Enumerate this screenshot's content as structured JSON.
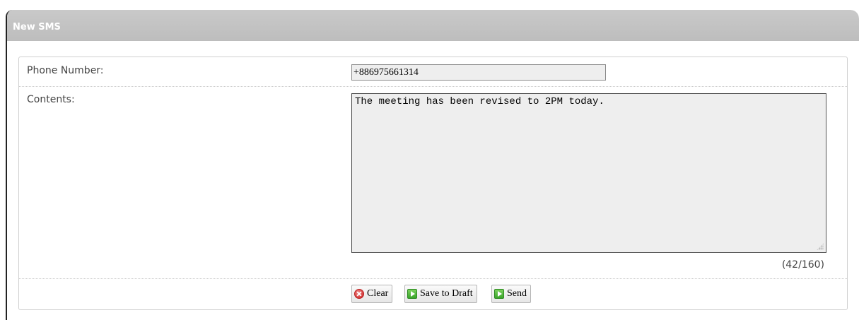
{
  "panel": {
    "title": "New SMS"
  },
  "form": {
    "phone_label": "Phone Number:",
    "phone_value": "+886975661314",
    "contents_label": "Contents:",
    "contents_value": "The meeting has been revised to 2PM today.",
    "counter": "(42/160)"
  },
  "buttons": {
    "clear": "Clear",
    "save_draft": "Save to Draft",
    "send": "Send"
  }
}
